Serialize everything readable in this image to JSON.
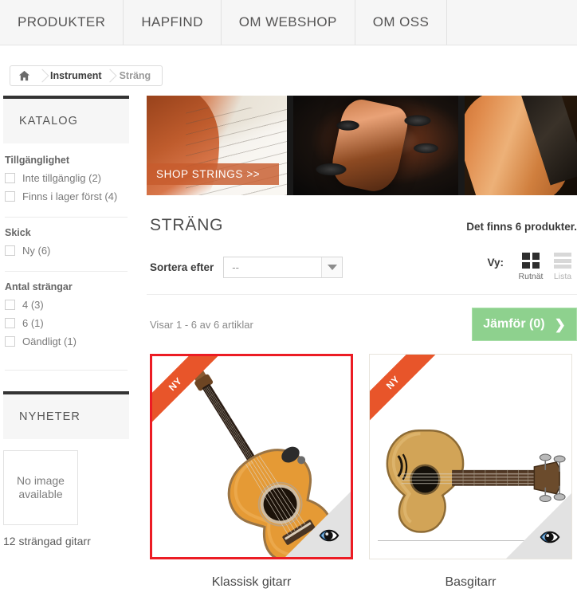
{
  "nav": {
    "items": [
      {
        "label": "PRODUKTER"
      },
      {
        "label": "HAPFIND"
      },
      {
        "label": "OM WEBSHOP"
      },
      {
        "label": "OM OSS"
      }
    ]
  },
  "breadcrumb": {
    "home_icon": "home-icon",
    "items": [
      {
        "label": "Instrument",
        "current": false
      },
      {
        "label": "Sträng",
        "current": true
      }
    ]
  },
  "sidebar": {
    "catalog": {
      "title": "KATALOG",
      "groups": [
        {
          "heading": "Tillgänglighet",
          "options": [
            {
              "label": "Inte tillgänglig (2)",
              "checked": false
            },
            {
              "label": "Finns i lager först (4)",
              "checked": false
            }
          ]
        },
        {
          "heading": "Skick",
          "options": [
            {
              "label": "Ny (6)",
              "checked": false
            }
          ]
        },
        {
          "heading": "Antal strängar",
          "options": [
            {
              "label": "4 (3)",
              "checked": false
            },
            {
              "label": "6 (1)",
              "checked": false
            },
            {
              "label": "Oändligt (1)",
              "checked": false
            }
          ]
        }
      ]
    },
    "news": {
      "title": "NYHETER",
      "items": [
        {
          "image_placeholder": "No image available",
          "name": "12 strängad gitarr"
        }
      ]
    }
  },
  "banner": {
    "cta_label": "SHOP STRINGS >>",
    "panels": [
      "sheet-music-violin",
      "tuning-pegs-closeup",
      "violin-body"
    ]
  },
  "main": {
    "category_title": "STRÄNG",
    "product_count_text": "Det finns 6 produkter.",
    "sort": {
      "label": "Sortera efter",
      "value": "--",
      "arrow_icon": "chevron-down-icon"
    },
    "view": {
      "label": "Vy:",
      "options": [
        {
          "caption": "Rutnät",
          "icon": "grid-icon",
          "active": true
        },
        {
          "caption": "Lista",
          "icon": "list-icon",
          "active": false
        }
      ]
    },
    "showing_text": "Visar 1 - 6 av 6 artiklar",
    "compare": {
      "label": "Jämför (0)",
      "icon": "chevron-right-icon",
      "color": "#8ed18e"
    },
    "products": [
      {
        "name": "Klassisk gitarr",
        "badge": "NY",
        "selected": true,
        "quickview_icon": "eye-icon",
        "image": "classical-guitar"
      },
      {
        "name": "Basgitarr",
        "badge": "NY",
        "selected": false,
        "quickview_icon": "eye-icon",
        "image": "bass-guitar"
      }
    ]
  },
  "colors": {
    "ribbon": "#e8552a",
    "selection_border": "#ec1c24",
    "compare_green": "#8ed18e",
    "nav_bg": "#f6f6f6",
    "block_top": "#333333"
  }
}
